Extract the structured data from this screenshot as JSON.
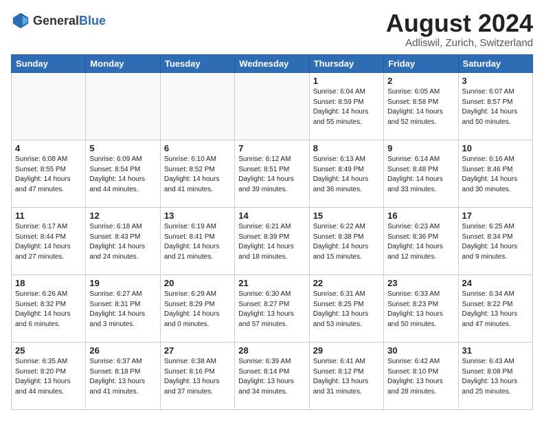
{
  "logo": {
    "general": "General",
    "blue": "Blue"
  },
  "title": {
    "month_year": "August 2024",
    "location": "Adliswil, Zurich, Switzerland"
  },
  "headers": [
    "Sunday",
    "Monday",
    "Tuesday",
    "Wednesday",
    "Thursday",
    "Friday",
    "Saturday"
  ],
  "weeks": [
    [
      {
        "day": "",
        "info": ""
      },
      {
        "day": "",
        "info": ""
      },
      {
        "day": "",
        "info": ""
      },
      {
        "day": "",
        "info": ""
      },
      {
        "day": "1",
        "info": "Sunrise: 6:04 AM\nSunset: 8:59 PM\nDaylight: 14 hours\nand 55 minutes."
      },
      {
        "day": "2",
        "info": "Sunrise: 6:05 AM\nSunset: 8:58 PM\nDaylight: 14 hours\nand 52 minutes."
      },
      {
        "day": "3",
        "info": "Sunrise: 6:07 AM\nSunset: 8:57 PM\nDaylight: 14 hours\nand 50 minutes."
      }
    ],
    [
      {
        "day": "4",
        "info": "Sunrise: 6:08 AM\nSunset: 8:55 PM\nDaylight: 14 hours\nand 47 minutes."
      },
      {
        "day": "5",
        "info": "Sunrise: 6:09 AM\nSunset: 8:54 PM\nDaylight: 14 hours\nand 44 minutes."
      },
      {
        "day": "6",
        "info": "Sunrise: 6:10 AM\nSunset: 8:52 PM\nDaylight: 14 hours\nand 41 minutes."
      },
      {
        "day": "7",
        "info": "Sunrise: 6:12 AM\nSunset: 8:51 PM\nDaylight: 14 hours\nand 39 minutes."
      },
      {
        "day": "8",
        "info": "Sunrise: 6:13 AM\nSunset: 8:49 PM\nDaylight: 14 hours\nand 36 minutes."
      },
      {
        "day": "9",
        "info": "Sunrise: 6:14 AM\nSunset: 8:48 PM\nDaylight: 14 hours\nand 33 minutes."
      },
      {
        "day": "10",
        "info": "Sunrise: 6:16 AM\nSunset: 8:46 PM\nDaylight: 14 hours\nand 30 minutes."
      }
    ],
    [
      {
        "day": "11",
        "info": "Sunrise: 6:17 AM\nSunset: 8:44 PM\nDaylight: 14 hours\nand 27 minutes."
      },
      {
        "day": "12",
        "info": "Sunrise: 6:18 AM\nSunset: 8:43 PM\nDaylight: 14 hours\nand 24 minutes."
      },
      {
        "day": "13",
        "info": "Sunrise: 6:19 AM\nSunset: 8:41 PM\nDaylight: 14 hours\nand 21 minutes."
      },
      {
        "day": "14",
        "info": "Sunrise: 6:21 AM\nSunset: 8:39 PM\nDaylight: 14 hours\nand 18 minutes."
      },
      {
        "day": "15",
        "info": "Sunrise: 6:22 AM\nSunset: 8:38 PM\nDaylight: 14 hours\nand 15 minutes."
      },
      {
        "day": "16",
        "info": "Sunrise: 6:23 AM\nSunset: 8:36 PM\nDaylight: 14 hours\nand 12 minutes."
      },
      {
        "day": "17",
        "info": "Sunrise: 6:25 AM\nSunset: 8:34 PM\nDaylight: 14 hours\nand 9 minutes."
      }
    ],
    [
      {
        "day": "18",
        "info": "Sunrise: 6:26 AM\nSunset: 8:32 PM\nDaylight: 14 hours\nand 6 minutes."
      },
      {
        "day": "19",
        "info": "Sunrise: 6:27 AM\nSunset: 8:31 PM\nDaylight: 14 hours\nand 3 minutes."
      },
      {
        "day": "20",
        "info": "Sunrise: 6:29 AM\nSunset: 8:29 PM\nDaylight: 14 hours\nand 0 minutes."
      },
      {
        "day": "21",
        "info": "Sunrise: 6:30 AM\nSunset: 8:27 PM\nDaylight: 13 hours\nand 57 minutes."
      },
      {
        "day": "22",
        "info": "Sunrise: 6:31 AM\nSunset: 8:25 PM\nDaylight: 13 hours\nand 53 minutes."
      },
      {
        "day": "23",
        "info": "Sunrise: 6:33 AM\nSunset: 8:23 PM\nDaylight: 13 hours\nand 50 minutes."
      },
      {
        "day": "24",
        "info": "Sunrise: 6:34 AM\nSunset: 8:22 PM\nDaylight: 13 hours\nand 47 minutes."
      }
    ],
    [
      {
        "day": "25",
        "info": "Sunrise: 6:35 AM\nSunset: 8:20 PM\nDaylight: 13 hours\nand 44 minutes."
      },
      {
        "day": "26",
        "info": "Sunrise: 6:37 AM\nSunset: 8:18 PM\nDaylight: 13 hours\nand 41 minutes."
      },
      {
        "day": "27",
        "info": "Sunrise: 6:38 AM\nSunset: 8:16 PM\nDaylight: 13 hours\nand 37 minutes."
      },
      {
        "day": "28",
        "info": "Sunrise: 6:39 AM\nSunset: 8:14 PM\nDaylight: 13 hours\nand 34 minutes."
      },
      {
        "day": "29",
        "info": "Sunrise: 6:41 AM\nSunset: 8:12 PM\nDaylight: 13 hours\nand 31 minutes."
      },
      {
        "day": "30",
        "info": "Sunrise: 6:42 AM\nSunset: 8:10 PM\nDaylight: 13 hours\nand 28 minutes."
      },
      {
        "day": "31",
        "info": "Sunrise: 6:43 AM\nSunset: 8:08 PM\nDaylight: 13 hours\nand 25 minutes."
      }
    ]
  ]
}
